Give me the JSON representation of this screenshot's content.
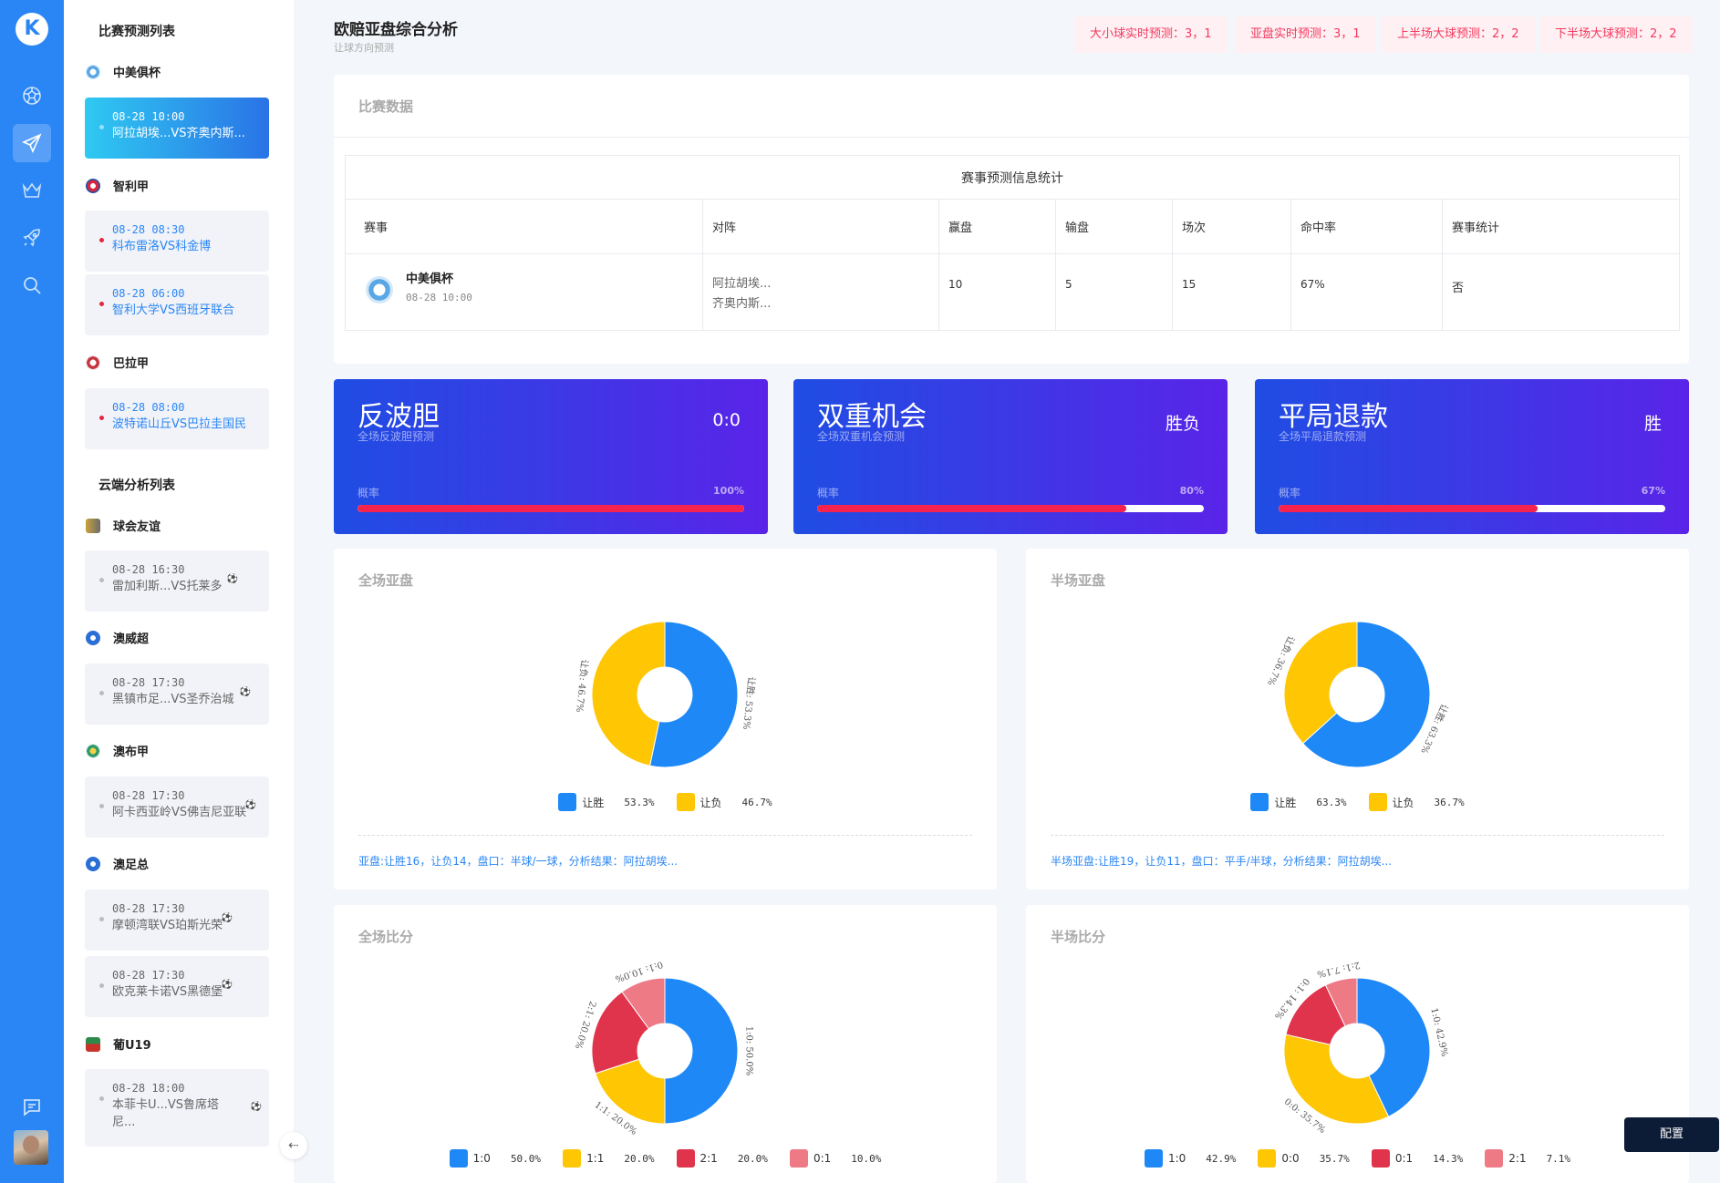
{
  "rail": {
    "logo": "K",
    "items": [
      {
        "icon": "football-icon"
      },
      {
        "icon": "paper-plane-icon",
        "active": true
      },
      {
        "icon": "crown-icon"
      },
      {
        "icon": "rocket-icon"
      },
      {
        "icon": "search-icon"
      },
      {
        "icon": "message-icon"
      }
    ]
  },
  "sidebar": {
    "prediction_title": "比赛预测列表",
    "cloud_title": "云端分析列表",
    "prediction_groups": [
      {
        "league": "中美俱杯",
        "badge_color": "#5aa7e6",
        "matches": [
          {
            "time": "08-28 10:00",
            "name": "阿拉胡埃...VS齐奥内斯...",
            "active": true
          }
        ]
      },
      {
        "league": "智利甲",
        "badge_color": "#d9263c",
        "matches": [
          {
            "time": "08-28 08:30",
            "name": "科布雷洛VS科金博"
          },
          {
            "time": "08-28 06:00",
            "name": "智利大学VS西班牙联合"
          }
        ]
      },
      {
        "league": "巴拉甲",
        "badge_color": "#c8343c",
        "matches": [
          {
            "time": "08-28 08:00",
            "name": "波特诺山丘VS巴拉圭国民"
          }
        ]
      }
    ],
    "cloud_groups": [
      {
        "league": "球会友谊",
        "badge_color": "#8c8c8c",
        "matches": [
          {
            "time": "08-28 16:30",
            "name": "雷加利斯...VS托莱多"
          }
        ]
      },
      {
        "league": "澳威超",
        "badge_color": "#2a6fd6",
        "matches": [
          {
            "time": "08-28 17:30",
            "name": "黑镇市足...VS圣乔治城"
          }
        ]
      },
      {
        "league": "澳布甲",
        "badge_color": "#2d9a6a",
        "matches": [
          {
            "time": "08-28 17:30",
            "name": "阿卡西亚岭VS佛吉尼亚联"
          }
        ]
      },
      {
        "league": "澳足总",
        "badge_color": "#2a6fd6",
        "matches": [
          {
            "time": "08-28 17:30",
            "name": "摩顿湾联VS珀斯光荣"
          },
          {
            "time": "08-28 17:30",
            "name": "欧克莱卡诺VS黑德堡"
          }
        ]
      },
      {
        "league": "葡U19",
        "badge_color": "#b5322c",
        "matches": [
          {
            "time": "08-28 18:00",
            "name": "本菲卡U...VS鲁席塔",
            "name2": "尼..."
          }
        ]
      }
    ]
  },
  "header": {
    "title": "欧赔亚盘综合分析",
    "subtitle": "让球方向预测",
    "tags": [
      "大小球实时预测：3，1",
      "亚盘实时预测：3，1",
      "上半场大球预测：2，2",
      "下半场大球预测：2，2"
    ]
  },
  "match_data": {
    "card_title": "比赛数据",
    "table_caption": "赛事预测信息统计",
    "headers": [
      "赛事",
      "对阵",
      "赢盘",
      "输盘",
      "场次",
      "命中率",
      "赛事统计"
    ],
    "row": {
      "league": "中美俱杯",
      "time": "08-28 10:00",
      "team1": "阿拉胡埃...",
      "team2": "齐奥内斯...",
      "win": "10",
      "lose": "5",
      "games": "15",
      "hit_rate": "67%",
      "stat": "否"
    }
  },
  "predictions": [
    {
      "title": "反波胆",
      "subtitle": "全场反波胆预测",
      "value": "0:0",
      "prob_label": "概率",
      "prob_text": "100%",
      "prob": 1.0
    },
    {
      "title": "双重机会",
      "subtitle": "全场双重机会预测",
      "value": "胜负",
      "prob_label": "概率",
      "prob_text": "80%",
      "prob": 0.8
    },
    {
      "title": "平局退款",
      "subtitle": "全场平局退款预测",
      "value": "胜",
      "prob_label": "概率",
      "prob_text": "67%",
      "prob": 0.67
    }
  ],
  "chart_data": [
    {
      "type": "pie",
      "title": "全场亚盘",
      "categories": [
        "让胜",
        "让负"
      ],
      "values": [
        53.3,
        46.7
      ],
      "value_labels": [
        "53.3%",
        "46.7%"
      ],
      "slice_labels": [
        "让胜: 53.3%",
        "让负: 46.7%"
      ],
      "colors": [
        "#1e88f6",
        "#fec603"
      ],
      "summary": "亚盘:让胜16，让负14，盘口：半球/一球，分析结果：阿拉胡埃..."
    },
    {
      "type": "pie",
      "title": "半场亚盘",
      "categories": [
        "让胜",
        "让负"
      ],
      "values": [
        63.3,
        36.7
      ],
      "value_labels": [
        "63.3%",
        "36.7%"
      ],
      "slice_labels": [
        "让胜: 63.3%",
        "让负: 36.7%"
      ],
      "colors": [
        "#1e88f6",
        "#fec603"
      ],
      "summary": "半场亚盘:让胜19，让负11，盘口：平手/半球，分析结果：阿拉胡埃..."
    },
    {
      "type": "pie",
      "title": "全场比分",
      "categories": [
        "1:0",
        "1:1",
        "2:1",
        "0:1"
      ],
      "values": [
        50.0,
        20.0,
        20.0,
        10.0
      ],
      "value_labels": [
        "50.0%",
        "20.0%",
        "20.0%",
        "10.0%"
      ],
      "slice_labels": [
        "1:0: 50.0%",
        "1:1: 20.0%",
        "2:1: 20.0%",
        "0:1: 10.0%"
      ],
      "colors": [
        "#1e88f6",
        "#fec603",
        "#e0344c",
        "#ee7a86"
      ]
    },
    {
      "type": "pie",
      "title": "半场比分",
      "categories": [
        "1:0",
        "0:0",
        "0:1",
        "2:1"
      ],
      "values": [
        42.9,
        35.7,
        14.3,
        7.1
      ],
      "value_labels": [
        "42.9%",
        "35.7%",
        "14.3%",
        "7.1%"
      ],
      "slice_labels": [
        "1:0: 42.9%",
        "0:0: 35.7%",
        "0:1: 14.3%",
        "2:1: 7.1%"
      ],
      "colors": [
        "#1e88f6",
        "#fec603",
        "#e0344c",
        "#ee7a86"
      ]
    }
  ],
  "config_button": "配置"
}
